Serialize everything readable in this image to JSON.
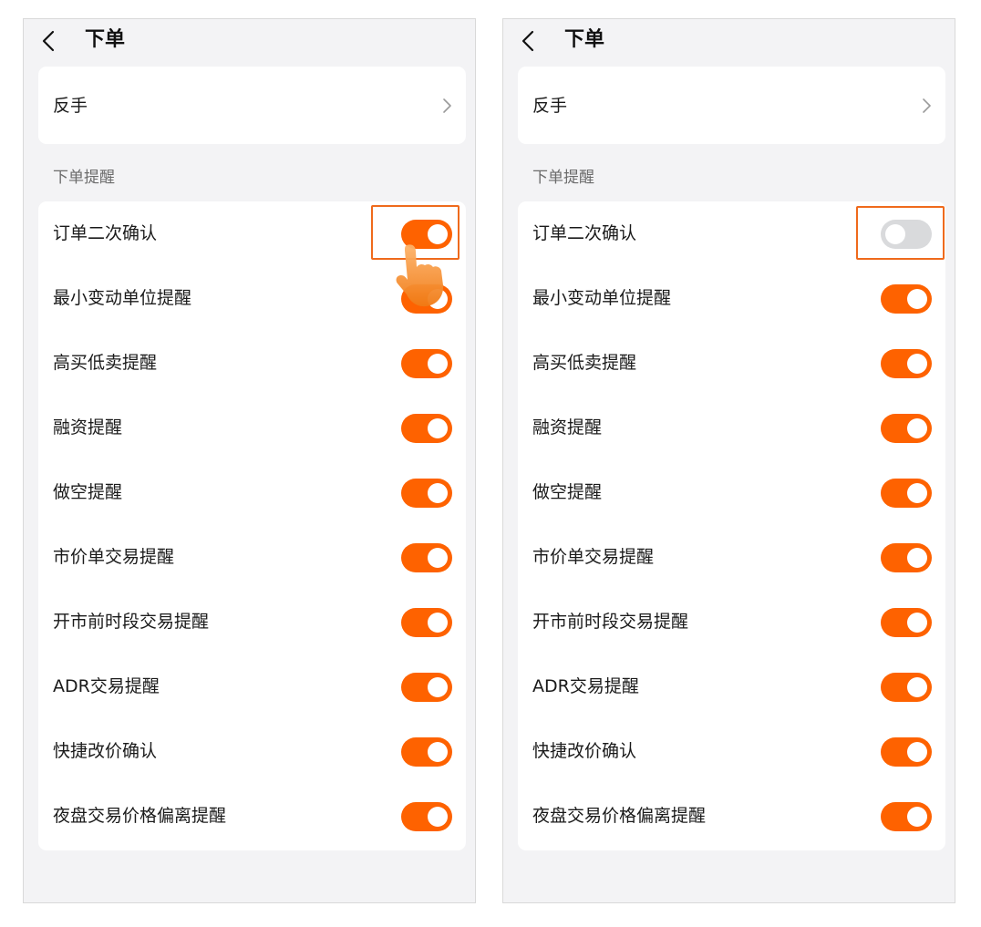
{
  "colors": {
    "accent": "#fe6200",
    "highlight": "#ef6a1c",
    "toggle_off": "#d9dadc",
    "background": "#f3f3f5"
  },
  "screens": [
    {
      "nav": {
        "title": "下单",
        "back_icon": "chevron-left-icon"
      },
      "reverse": {
        "label": "反手",
        "chevron_icon": "chevron-right-icon"
      },
      "section_title": "下单提醒",
      "items": [
        {
          "label": "订单二次确认",
          "on": true
        },
        {
          "label": "最小变动单位提醒",
          "on": true
        },
        {
          "label": "高买低卖提醒",
          "on": true
        },
        {
          "label": "融资提醒",
          "on": true
        },
        {
          "label": "做空提醒",
          "on": true
        },
        {
          "label": "市价单交易提醒",
          "on": true
        },
        {
          "label": "开市前时段交易提醒",
          "on": true
        },
        {
          "label": "ADR交易提醒",
          "on": true
        },
        {
          "label": "快捷改价确认",
          "on": true
        },
        {
          "label": "夜盘交易价格偏离提醒",
          "on": true
        }
      ],
      "annotation": {
        "highlighted_item": "订单二次确认",
        "pointer_icon": "tap-hand-icon"
      }
    },
    {
      "nav": {
        "title": "下单",
        "back_icon": "chevron-left-icon"
      },
      "reverse": {
        "label": "反手",
        "chevron_icon": "chevron-right-icon"
      },
      "section_title": "下单提醒",
      "items": [
        {
          "label": "订单二次确认",
          "on": false
        },
        {
          "label": "最小变动单位提醒",
          "on": true
        },
        {
          "label": "高买低卖提醒",
          "on": true
        },
        {
          "label": "融资提醒",
          "on": true
        },
        {
          "label": "做空提醒",
          "on": true
        },
        {
          "label": "市价单交易提醒",
          "on": true
        },
        {
          "label": "开市前时段交易提醒",
          "on": true
        },
        {
          "label": "ADR交易提醒",
          "on": true
        },
        {
          "label": "快捷改价确认",
          "on": true
        },
        {
          "label": "夜盘交易价格偏离提醒",
          "on": true
        }
      ],
      "annotation": {
        "highlighted_item": "订单二次确认"
      }
    }
  ]
}
